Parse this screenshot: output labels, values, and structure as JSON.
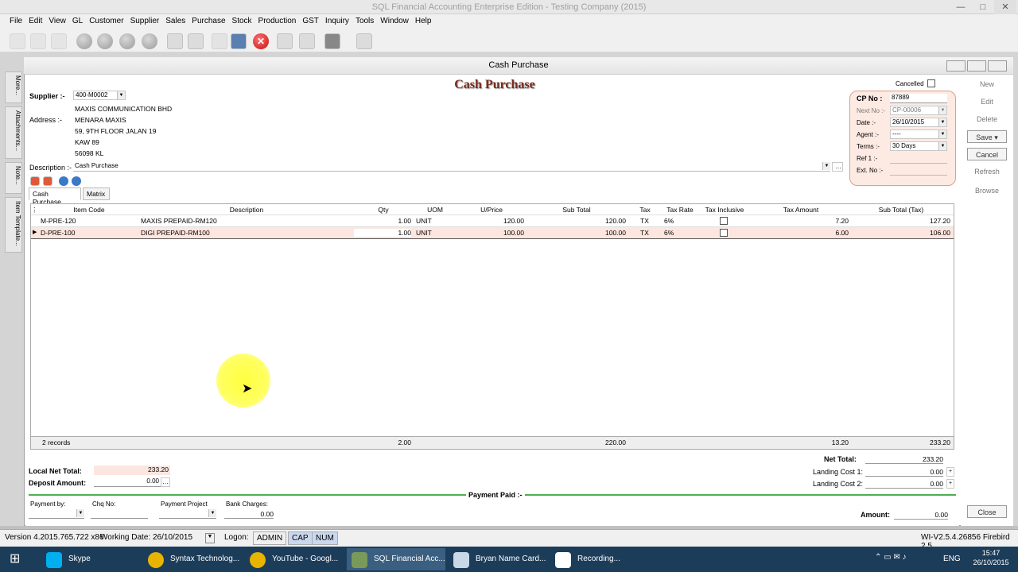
{
  "window": {
    "title": "SQL Financial Accounting Enterprise Edition - Testing Company (2015)",
    "controls": [
      "—",
      "□",
      "✕"
    ]
  },
  "menu": [
    "File",
    "Edit",
    "View",
    "GL",
    "Customer",
    "Supplier",
    "Sales",
    "Purchase",
    "Stock",
    "Production",
    "GST",
    "Inquiry",
    "Tools",
    "Window",
    "Help"
  ],
  "side_tabs": [
    "More...",
    "Attachments...",
    "Note...",
    "Item Template..."
  ],
  "child_window": {
    "title": "Cash Purchase"
  },
  "form": {
    "heading": "Cash Purchase",
    "supplier_label": "Supplier :-",
    "supplier_code": "400-M0002",
    "supplier_name": "MAXIS COMMUNICATION BHD",
    "address_label": "Address :-",
    "address_lines": [
      "MENARA MAXIS",
      "59, 9TH FLOOR JALAN 19",
      "KAW 89",
      "56098 KL"
    ],
    "description_label": "Description :-",
    "description": "Cash Purchase",
    "cancelled_label": "Cancelled",
    "cp_no_label": "CP No :",
    "cp_no": "87889",
    "next_no_label": "Next No :-",
    "next_no": "CP-00006",
    "date_label": "Date :-",
    "date": "26/10/2015",
    "agent_label": "Agent :-",
    "agent": "----",
    "terms_label": "Terms :-",
    "terms": "30 Days",
    "ref1_label": "Ref 1 :-",
    "extno_label": "Ext. No :-"
  },
  "right_buttons": {
    "new": "New",
    "edit": "Edit",
    "delete": "Delete",
    "save": "Save",
    "cancel": "Cancel",
    "refresh": "Refresh",
    "browse": "Browse",
    "close": "Close"
  },
  "tabs": [
    "Cash Purchase",
    "Matrix"
  ],
  "grid": {
    "columns": [
      "Item Code",
      "Description",
      "Qty",
      "UOM",
      "U/Price",
      "Sub Total",
      "Tax",
      "Tax Rate",
      "Tax Inclusive",
      "Tax Amount",
      "Sub Total (Tax)"
    ],
    "rows": [
      {
        "item_code": "M-PRE-120",
        "description": "MAXIS PREPAID-RM120",
        "qty": "1.00",
        "uom": "UNIT",
        "price": "120.00",
        "subtotal": "120.00",
        "tax": "TX",
        "rate": "6%",
        "tax_amount": "7.20",
        "subtotal_tax": "127.20"
      },
      {
        "item_code": "D-PRE-100",
        "description": "DIGI PREPAID-RM100",
        "qty": "1.00",
        "uom": "UNIT",
        "price": "100.00",
        "subtotal": "100.00",
        "tax": "TX",
        "rate": "6%",
        "tax_amount": "6.00",
        "subtotal_tax": "106.00"
      }
    ],
    "footer": {
      "records": "2 records",
      "qty": "2.00",
      "subtotal": "220.00",
      "tax_amount": "13.20",
      "subtotal_tax": "233.20"
    }
  },
  "totals": {
    "local_net_label": "Local Net Total:",
    "local_net": "233.20",
    "deposit_label": "Deposit Amount:",
    "deposit": "0.00",
    "net_label": "Net Total:",
    "net": "233.20",
    "landing1_label": "Landing Cost 1:",
    "landing1": "0.00",
    "landing2_label": "Landing Cost 2:",
    "landing2": "0.00"
  },
  "payment": {
    "title": "Payment Paid :-",
    "payment_by_label": "Payment by:",
    "chq_label": "Chq No:",
    "project_label": "Payment Project",
    "bank_label": "Bank Charges:",
    "bank": "0.00",
    "amount_label": "Amount:",
    "amount": "0.00"
  },
  "status": {
    "version": "Version 4.2015.765.722 x86",
    "working_date_label": "Working Date:",
    "working_date": "26/10/2015",
    "logon_label": "Logon:",
    "logon": "ADMIN",
    "cap": "CAP",
    "num": "NUM",
    "build": "WI-V2.5.4.26856 Firebird 2.5"
  },
  "taskbar": {
    "items": [
      "Skype",
      "Syntax Technolog...",
      "YouTube - Googl...",
      "SQL Financial Acc...",
      "Bryan Name Card...",
      "Recording..."
    ],
    "lang": "ENG",
    "time": "15:47",
    "date": "26/10/2015"
  },
  "colors": {
    "heading": "#7a2c1e",
    "row_highlight": "#fde6df",
    "pay_bar": "#4caf50",
    "taskbar": "#1c3d5a"
  }
}
